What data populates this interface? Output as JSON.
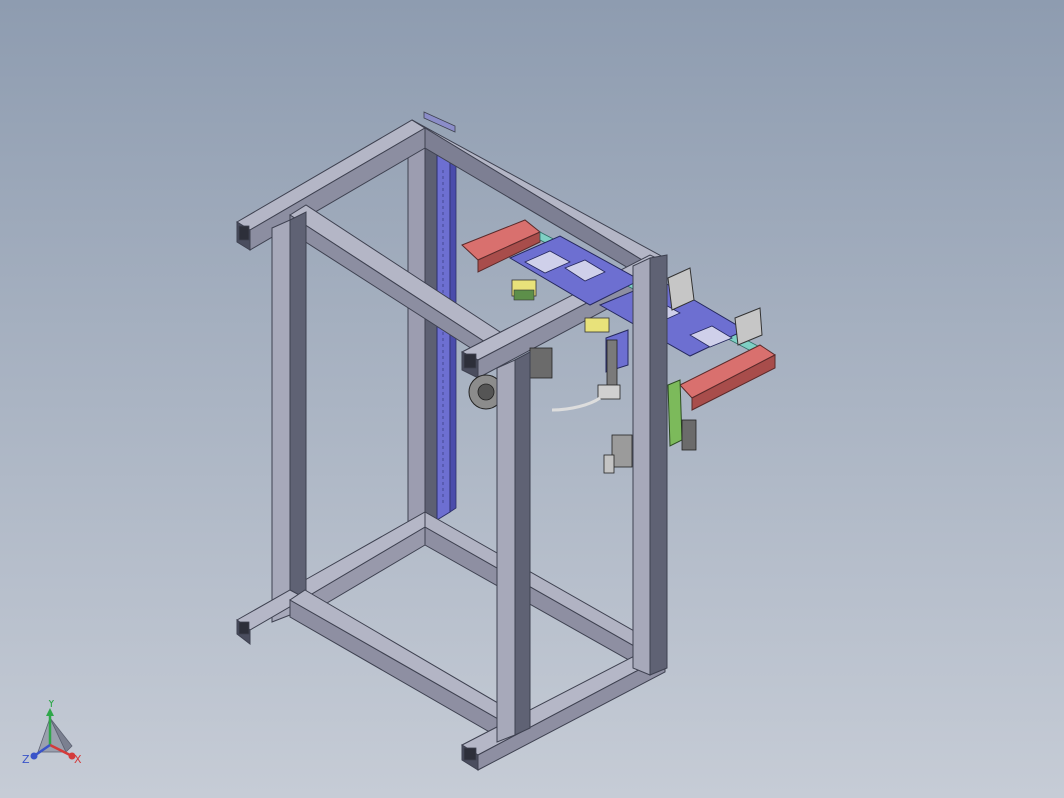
{
  "viewport": {
    "background_top": "#8e9cb0",
    "background_bottom": "#c6ccd6"
  },
  "model": {
    "frame_color": "#5e6173",
    "frame_face": "#9899ab",
    "frame_dark": "#3e4150",
    "rail_color": "#6d6fd1",
    "motor_color": "#c6c6c6",
    "plate_red": "#d9706e",
    "bracket_green": "#7cba5b",
    "cable_color": "#dddddd"
  },
  "triad": {
    "x_label": "X",
    "y_label": "Y",
    "z_label": "Z",
    "x_color": "#d43a3a",
    "y_color": "#2fa74a",
    "z_color": "#3a54c9"
  }
}
